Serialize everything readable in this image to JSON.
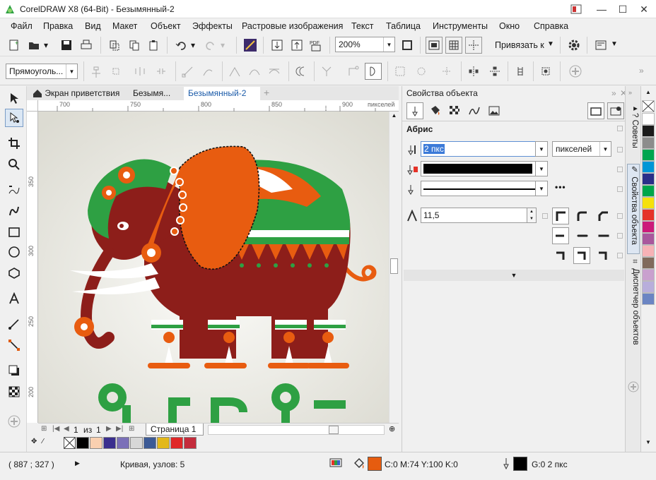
{
  "window": {
    "title": "CorelDRAW X8 (64-Bit) - Безымянный-2"
  },
  "menu": [
    "Файл",
    "Правка",
    "Вид",
    "Макет",
    "Объект",
    "Эффекты",
    "Растровые изображения",
    "Текст",
    "Таблица",
    "Инструменты",
    "Окно",
    "Справка"
  ],
  "toolbar": {
    "zoom": "200%",
    "snap_label": "Привязать к"
  },
  "propbar": {
    "shape_select": "Прямоуголь..."
  },
  "tabs": [
    "Экран приветствия",
    "Безымя...",
    "Безымянный-2"
  ],
  "ruler": {
    "h_ticks": [
      "700",
      "750",
      "800",
      "850",
      "900"
    ],
    "h_unit": "пикселей",
    "v_ticks": [
      "350",
      "300",
      "250",
      "200"
    ]
  },
  "pagenav": {
    "current": "1",
    "of": "из",
    "total": "1",
    "page_tab": "Страница 1"
  },
  "docker": {
    "title": "Свойства объекта",
    "section": "Абрис",
    "width_value": "2 пкс",
    "units_value": "пикселей",
    "miter_value": "11,5"
  },
  "sidetabs": [
    "Советы",
    "Свойства объекта",
    "Диспетчер объектов"
  ],
  "palette_colors": [
    "#ffffff",
    "#1a1a1a",
    "#8c8c8c",
    "#00a54f",
    "#0096d6",
    "#2b2f89",
    "#00a64a",
    "#f5e10c",
    "#e53228",
    "#cc1a7a",
    "#a9579d",
    "#f7b2b6",
    "#806a5b",
    "#c9a0ce",
    "#b8aedb",
    "#6b85c3"
  ],
  "doc_palette": [
    "#000000",
    "#f9d0b0",
    "#3a2f8e",
    "#7b70b8",
    "#d8d8d8",
    "#3c5a96",
    "#e3b81a",
    "#e02828",
    "#c42c3c"
  ],
  "status": {
    "coords": "( 887 ; 327 )",
    "object_info": "Кривая, узлов: 5",
    "fill_text": "C:0 M:74 Y:100 K:0",
    "fill_color": "#e65c0f",
    "outline_text": "G:0  2 пкс"
  }
}
